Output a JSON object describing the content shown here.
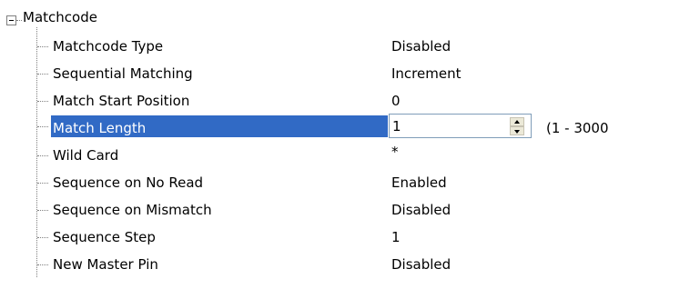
{
  "tree": {
    "root": {
      "label": "Matchcode",
      "expanded": true
    },
    "items": [
      {
        "label": "Matchcode Type",
        "value": "Disabled"
      },
      {
        "label": "Sequential Matching",
        "value": "Increment"
      },
      {
        "label": "Match Start Position",
        "value": "0"
      },
      {
        "label": "Match Length",
        "value": "1",
        "selected": true
      },
      {
        "label": "Wild Card",
        "value": "*"
      },
      {
        "label": "Sequence on No Read",
        "value": "Enabled"
      },
      {
        "label": "Sequence on Mismatch",
        "value": "Disabled"
      },
      {
        "label": "Sequence Step",
        "value": "1"
      },
      {
        "label": "New Master Pin",
        "value": "Disabled"
      }
    ],
    "editor": {
      "range_text": "(1 - 3000"
    }
  },
  "colors": {
    "selection": "#316ac5",
    "connector": "#808080"
  },
  "icons": {
    "expander": "minus-box-icon",
    "spin_up": "arrow-up-icon",
    "spin_down": "arrow-down-icon"
  }
}
